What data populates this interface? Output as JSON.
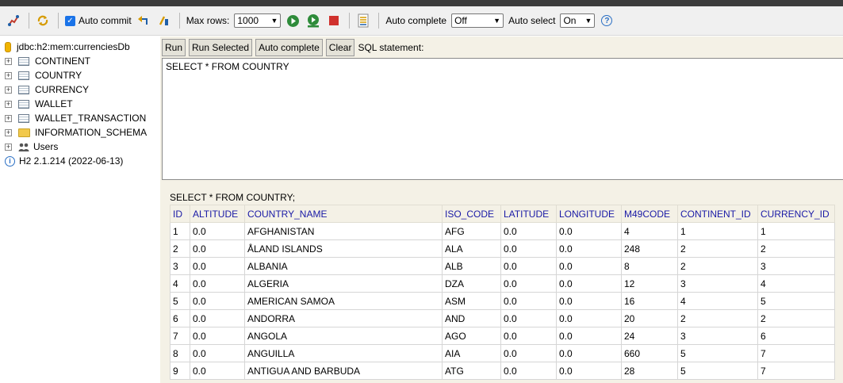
{
  "toolbar": {
    "auto_commit_label": "Auto commit",
    "max_rows_label": "Max rows:",
    "max_rows_value": "1000",
    "auto_complete_label": "Auto complete",
    "auto_complete_value": "Off",
    "auto_select_label": "Auto select",
    "auto_select_value": "On",
    "help_glyph": "?"
  },
  "sidebar": {
    "connection": "jdbc:h2:mem:currenciesDb",
    "tables": [
      "CONTINENT",
      "COUNTRY",
      "CURRENCY",
      "WALLET",
      "WALLET_TRANSACTION"
    ],
    "schema": "INFORMATION_SCHEMA",
    "users": "Users",
    "version": "H2 2.1.214 (2022-06-13)"
  },
  "buttons": {
    "run": "Run",
    "run_selected": "Run Selected",
    "auto_complete": "Auto complete",
    "clear": "Clear",
    "sql_statement_label": "SQL statement:"
  },
  "editor": {
    "query": "SELECT * FROM COUNTRY"
  },
  "result": {
    "title": "SELECT * FROM COUNTRY;",
    "columns": [
      "ID",
      "ALTITUDE",
      "COUNTRY_NAME",
      "ISO_CODE",
      "LATITUDE",
      "LONGITUDE",
      "M49CODE",
      "CONTINENT_ID",
      "CURRENCY_ID"
    ],
    "rows": [
      [
        "1",
        "0.0",
        "AFGHANISTAN",
        "AFG",
        "0.0",
        "0.0",
        "4",
        "1",
        "1"
      ],
      [
        "2",
        "0.0",
        "ÅLAND ISLANDS",
        "ALA",
        "0.0",
        "0.0",
        "248",
        "2",
        "2"
      ],
      [
        "3",
        "0.0",
        "ALBANIA",
        "ALB",
        "0.0",
        "0.0",
        "8",
        "2",
        "3"
      ],
      [
        "4",
        "0.0",
        "ALGERIA",
        "DZA",
        "0.0",
        "0.0",
        "12",
        "3",
        "4"
      ],
      [
        "5",
        "0.0",
        "AMERICAN SAMOA",
        "ASM",
        "0.0",
        "0.0",
        "16",
        "4",
        "5"
      ],
      [
        "6",
        "0.0",
        "ANDORRA",
        "AND",
        "0.0",
        "0.0",
        "20",
        "2",
        "2"
      ],
      [
        "7",
        "0.0",
        "ANGOLA",
        "AGO",
        "0.0",
        "0.0",
        "24",
        "3",
        "6"
      ],
      [
        "8",
        "0.0",
        "ANGUILLA",
        "AIA",
        "0.0",
        "0.0",
        "660",
        "5",
        "7"
      ],
      [
        "9",
        "0.0",
        "ANTIGUA AND BARBUDA",
        "ATG",
        "0.0",
        "0.0",
        "28",
        "5",
        "7"
      ]
    ]
  }
}
